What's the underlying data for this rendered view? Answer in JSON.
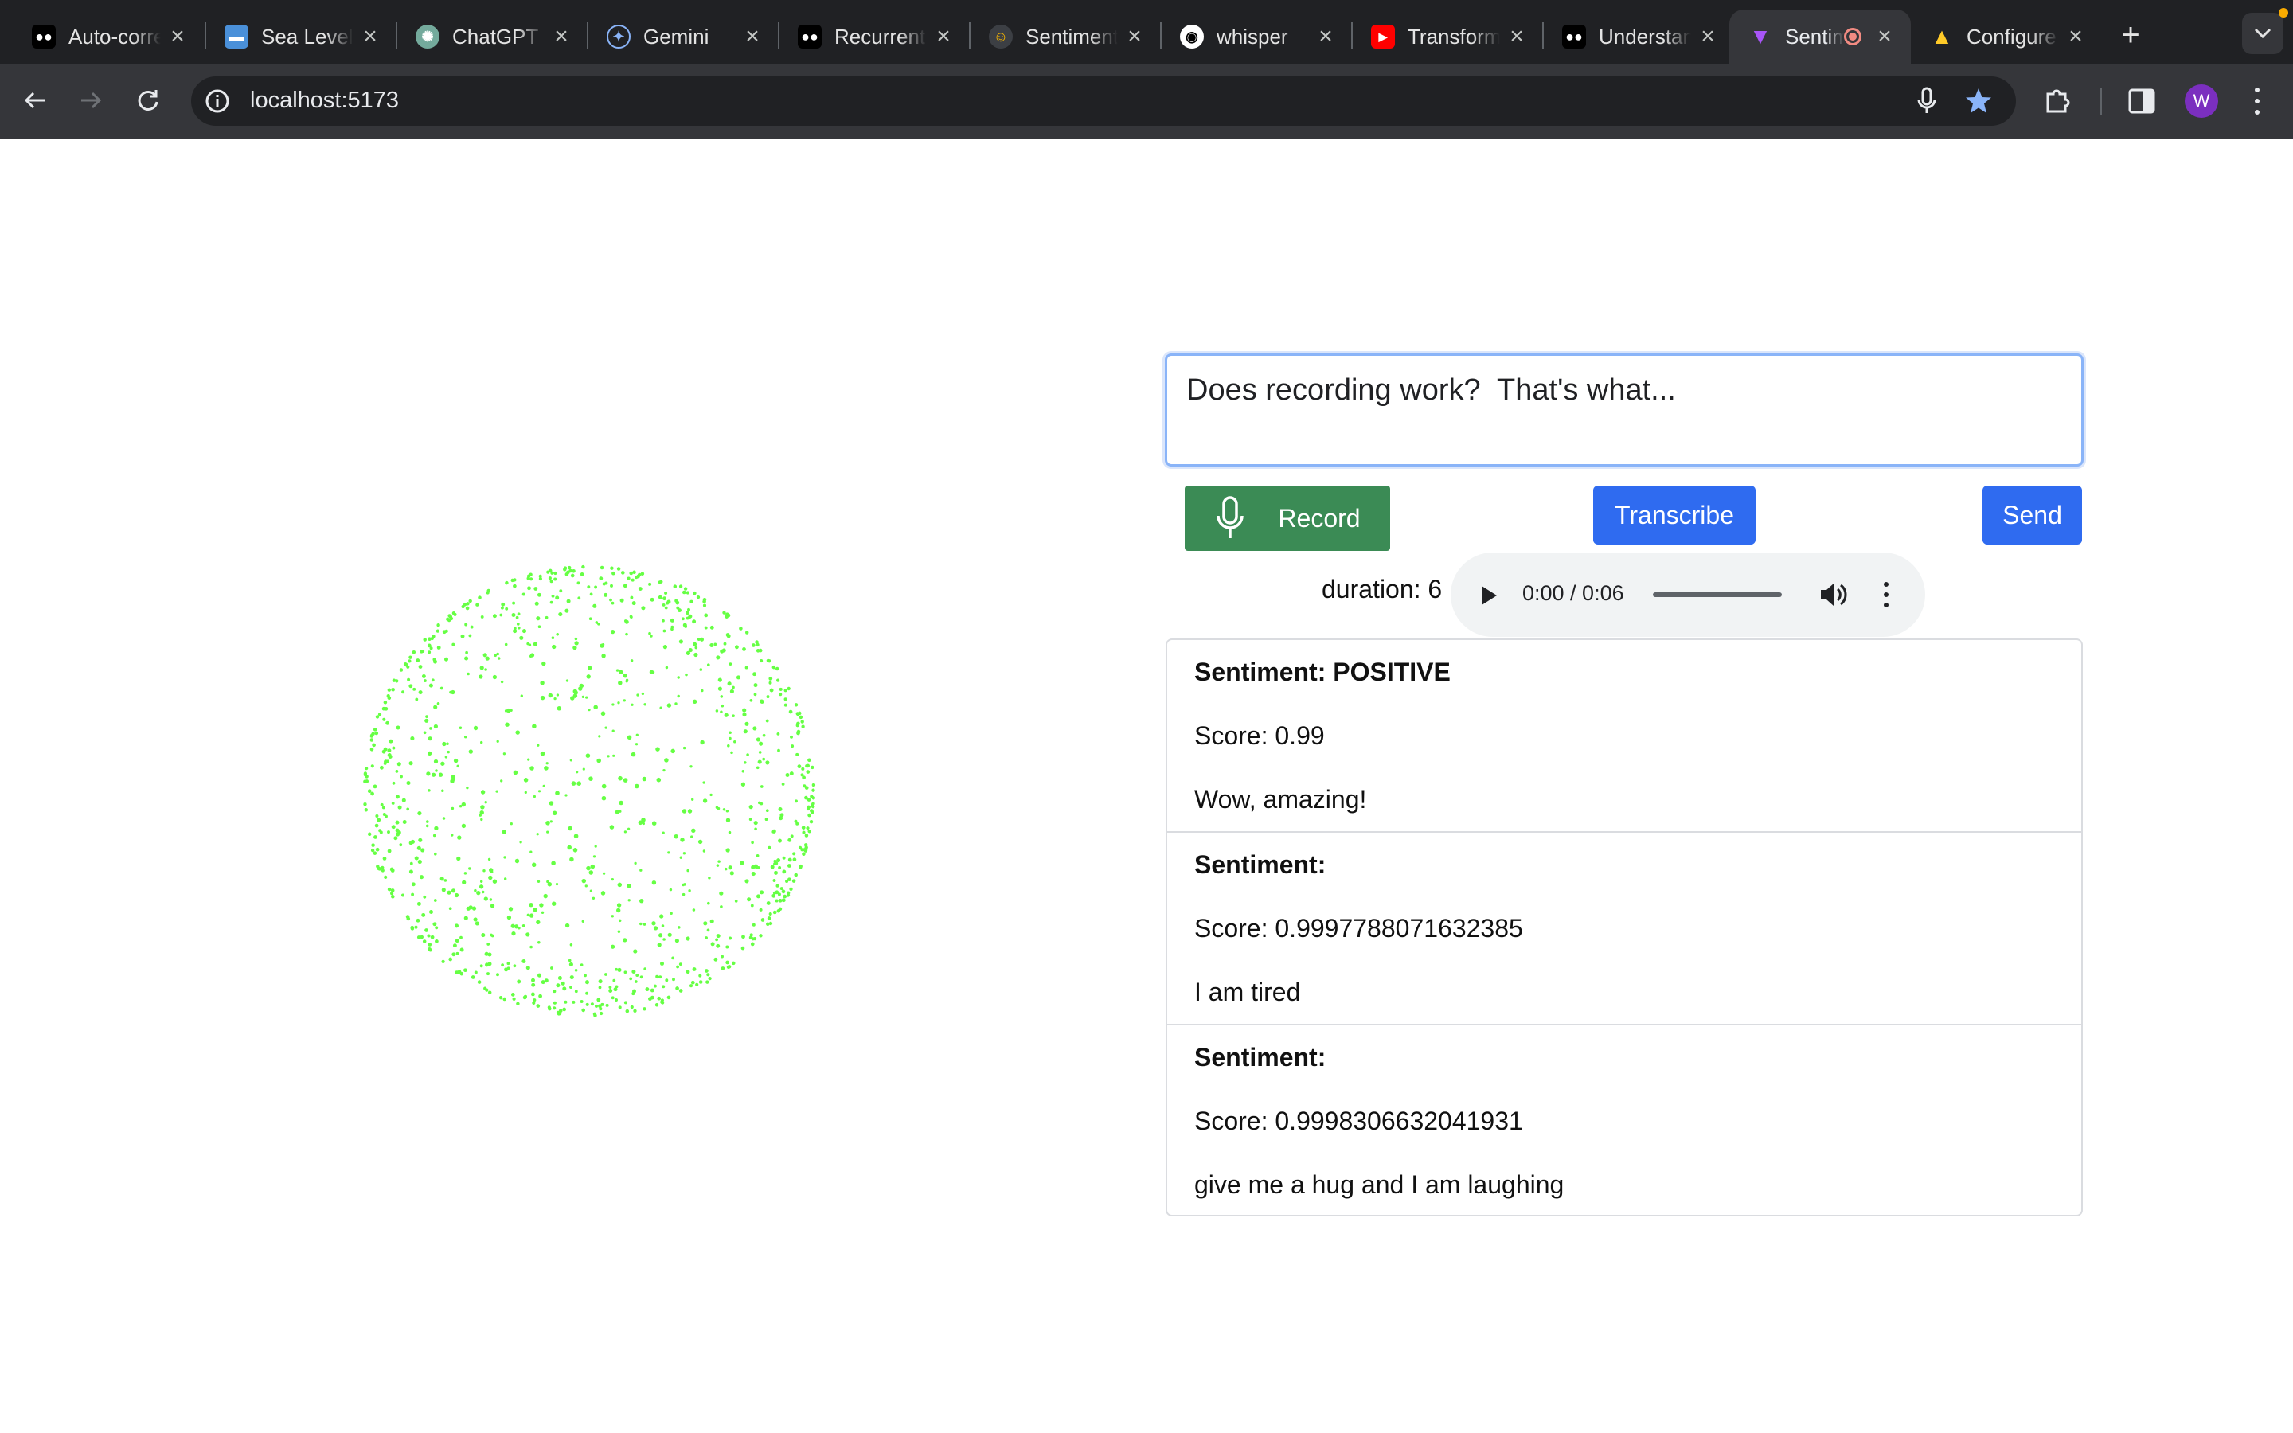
{
  "browser": {
    "tabs": [
      {
        "title": "Auto-correct",
        "icon": "medium-icon",
        "color": "#000000"
      },
      {
        "title": "Sea Level",
        "icon": "sea-level-icon",
        "color": "#4a90d9"
      },
      {
        "title": "ChatGPT",
        "icon": "chatgpt-icon",
        "color": "#74aa9c"
      },
      {
        "title": "Gemini",
        "icon": "gemini-icon",
        "color": "#4285f4"
      },
      {
        "title": "Recurrent",
        "icon": "medium-icon",
        "color": "#000000"
      },
      {
        "title": "Sentiment",
        "icon": "hugging-face-icon",
        "color": "#7a5af8"
      },
      {
        "title": "whisper",
        "icon": "github-icon",
        "color": "#ffffff"
      },
      {
        "title": "Transformer",
        "icon": "youtube-icon",
        "color": "#ff0000"
      },
      {
        "title": "Understanding",
        "icon": "medium-icon",
        "color": "#000000"
      },
      {
        "title": "Sentiment",
        "icon": "vite-icon",
        "color": "#a855f7",
        "active": true
      },
      {
        "title": "Configure",
        "icon": "firebase-icon",
        "color": "#ffca28"
      }
    ],
    "new_tab_label": "+",
    "url": "localhost:5173",
    "profile_initial": "W",
    "accent_color": "#8ab4f8"
  },
  "app": {
    "prompt_value": "Does recording work?  That's what...",
    "record_label": "Record",
    "transcribe_label": "Transcribe",
    "send_label": "Send",
    "duration_text": "duration: 6",
    "player_time": "0:00 / 0:06",
    "playback_fraction": 0,
    "results": [
      {
        "sentiment": "Sentiment: POSITIVE",
        "score": "Score: 0.99",
        "text": "Wow, amazing!"
      },
      {
        "sentiment": "Sentiment:",
        "score": "Score: 0.9997788071632385",
        "text": "I am tired"
      },
      {
        "sentiment": "Sentiment:",
        "score": "Score: 0.9998306632041931",
        "text": "give me a hug and I am laughing"
      }
    ],
    "colors": {
      "record": "#3b8b55",
      "primary": "#2f6bf0",
      "particles": "#66ff44"
    }
  }
}
